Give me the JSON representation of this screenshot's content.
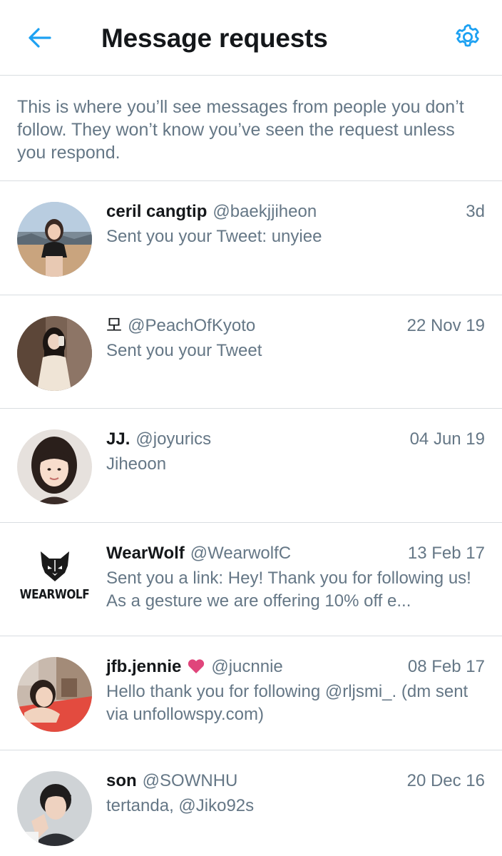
{
  "header": {
    "title": "Message requests",
    "back_icon": "arrow-left-icon",
    "settings_icon": "gear-icon",
    "accent_color": "#1da1f2"
  },
  "description": "This is where you’ll see messages from people you don’t follow. They won’t know you’ve seen the request unless you respond.",
  "requests": [
    {
      "name": "ceril cangtip",
      "handle": "@baekjjiheon",
      "time": "3d",
      "preview": "Sent you your Tweet: unyiee"
    },
    {
      "name": "모",
      "handle": "@PeachOfKyoto",
      "time": "22 Nov 19",
      "preview": "Sent you your Tweet"
    },
    {
      "name": "JJ.",
      "handle": "@joyurics",
      "time": "04 Jun 19",
      "preview": "Jiheoon"
    },
    {
      "name": "WearWolf",
      "handle": "@WearwolfC",
      "time": "13 Feb 17",
      "preview": "Sent you a link: Hey! Thank you for following us! As a gesture we are offering 10% off e...",
      "logo_text": "WEARWOLF"
    },
    {
      "name": "jfb.jennie",
      "handle": "@jucnnie",
      "time": "08 Feb 17",
      "preview": "Hello thank you for following @rljsmi_. (dm sent via unfollowspy.com)",
      "badge_icon": "pink-heart-icon"
    },
    {
      "name": "son",
      "handle": "@SOWNHU",
      "time": "20 Dec 16",
      "preview": "tertanda, @Jiko92s"
    }
  ]
}
